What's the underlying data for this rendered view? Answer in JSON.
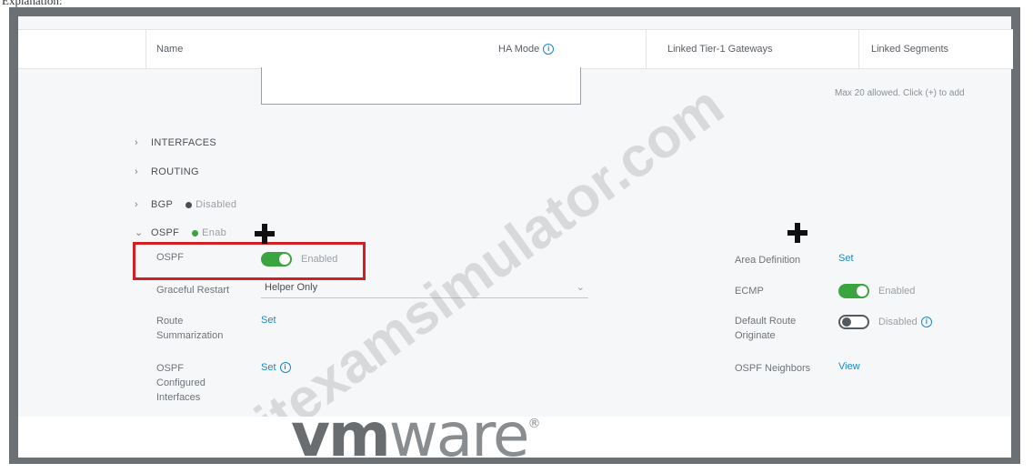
{
  "caption": "Explanation:",
  "table_header": {
    "name": "Name",
    "ha_mode": "HA Mode",
    "linked_tier1": "Linked Tier-1 Gateways",
    "linked_segments": "Linked Segments"
  },
  "hint": "Max 20 allowed. Click (+) to add",
  "sections": {
    "interfaces": "INTERFACES",
    "routing": "ROUTING",
    "bgp": "BGP",
    "bgp_status": "Disabled",
    "ospf": "OSPF",
    "ospf_status": "Enab"
  },
  "ospf_form": {
    "ospf_label": "OSPF",
    "ospf_toggle": "Enabled",
    "graceful_label": "Graceful Restart",
    "graceful_value": "Helper Only",
    "route_sum_label_1": "Route",
    "route_sum_label_2": "Summarization",
    "route_sum_link": "Set",
    "ospf_if_label_1": "OSPF",
    "ospf_if_label_2": "Configured",
    "ospf_if_label_3": "Interfaces",
    "ospf_if_link": "Set",
    "area_label": "Area Definition",
    "area_link": "Set",
    "ecmp_label": "ECMP",
    "ecmp_toggle": "Enabled",
    "default_route_label_1": "Default Route",
    "default_route_label_2": "Originate",
    "default_route_toggle": "Disabled",
    "neighbors_label": "OSPF Neighbors",
    "neighbors_link": "View"
  },
  "watermark": "itexamsimulator.com",
  "logo": {
    "bold": "vm",
    "light": "ware"
  },
  "colors": {
    "accent": "#1b87c9",
    "toggle_on": "#3aa53e",
    "highlight": "#d21f26"
  }
}
